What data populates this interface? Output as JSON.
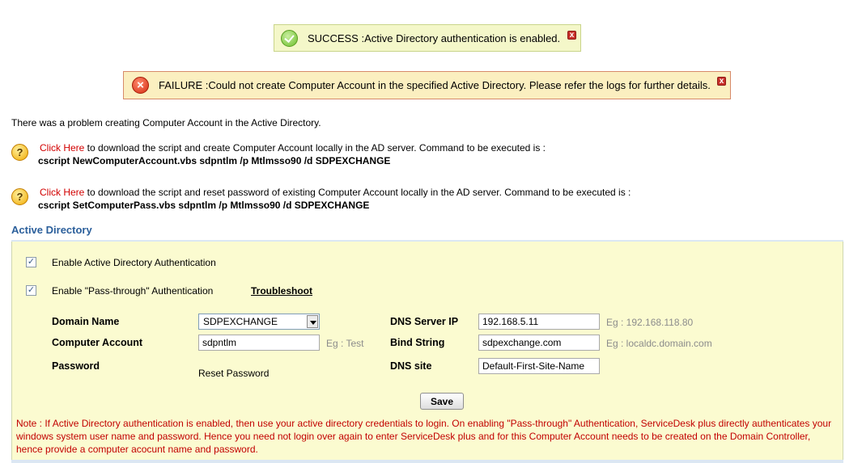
{
  "messages": {
    "success": "SUCCESS :Active Directory authentication is enabled.",
    "failure": "FAILURE :Could not create Computer Account in the specified Active Directory. Please refer the logs for further details.",
    "close_glyph": "x"
  },
  "problem_text": "There was a problem creating Computer Account in the Active Directory.",
  "help": [
    {
      "link": "Click Here",
      "text": " to download the script and create Computer Account locally in the AD server. Command to be executed is :",
      "command": "cscript NewComputerAccount.vbs sdpntlm /p Mtlmsso90 /d SDPEXCHANGE"
    },
    {
      "link": "Click Here",
      "text": " to download the script and reset password of existing Computer Account locally in the AD server. Command to be executed is :",
      "command": "cscript SetComputerPass.vbs sdpntlm /p Mtlmsso90 /d SDPEXCHANGE"
    }
  ],
  "section_title": "Active Directory",
  "options": {
    "enable_ad": "Enable Active Directory Authentication",
    "enable_passthrough": "Enable \"Pass-through\" Authentication",
    "troubleshoot": "Troubleshoot"
  },
  "form": {
    "domain_label": "Domain Name",
    "domain_value": "SDPEXCHANGE",
    "computer_label": "Computer Account",
    "computer_value": "sdpntlm",
    "computer_hint": "Eg : Test",
    "password_label": "Password",
    "reset_password": "Reset Password",
    "dns_ip_label": "DNS Server IP",
    "dns_ip_value": "192.168.5.11",
    "dns_ip_hint": "Eg : 192.168.118.80",
    "bind_label": "Bind String",
    "bind_value": "sdpexchange.com",
    "bind_hint": "Eg : localdc.domain.com",
    "site_label": "DNS site",
    "site_value": "Default-First-Site-Name"
  },
  "save_label": "Save",
  "note": "Note : If Active Directory authentication is enabled, then use your active directory credentials to login.  On enabling \"Pass-through\" Authentication, ServiceDesk plus directly authenticates your windows system user name and password. Hence you need not login over again to enter ServiceDesk plus and for this Computer Account needs to be created on the Domain Controller, hence provide a computer acocunt name and password.",
  "colors": {
    "accent": "#2b5f9b",
    "note_red": "#c20000",
    "panel_bg": "#fbfbd0"
  }
}
